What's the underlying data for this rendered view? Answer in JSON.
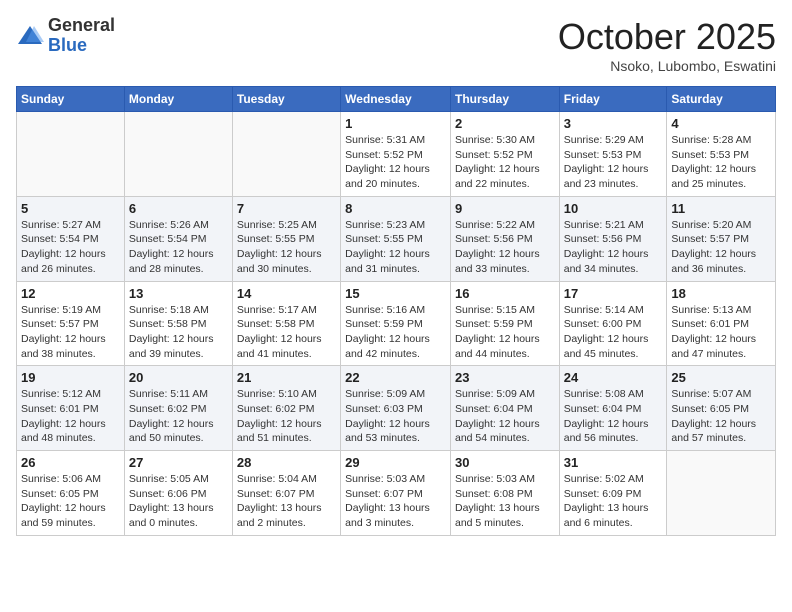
{
  "header": {
    "logo_general": "General",
    "logo_blue": "Blue",
    "month_year": "October 2025",
    "location": "Nsoko, Lubombo, Eswatini"
  },
  "weekdays": [
    "Sunday",
    "Monday",
    "Tuesday",
    "Wednesday",
    "Thursday",
    "Friday",
    "Saturday"
  ],
  "weeks": [
    [
      {
        "day": "",
        "sunrise": "",
        "sunset": "",
        "daylight": ""
      },
      {
        "day": "",
        "sunrise": "",
        "sunset": "",
        "daylight": ""
      },
      {
        "day": "",
        "sunrise": "",
        "sunset": "",
        "daylight": ""
      },
      {
        "day": "1",
        "sunrise": "Sunrise: 5:31 AM",
        "sunset": "Sunset: 5:52 PM",
        "daylight": "Daylight: 12 hours and 20 minutes."
      },
      {
        "day": "2",
        "sunrise": "Sunrise: 5:30 AM",
        "sunset": "Sunset: 5:52 PM",
        "daylight": "Daylight: 12 hours and 22 minutes."
      },
      {
        "day": "3",
        "sunrise": "Sunrise: 5:29 AM",
        "sunset": "Sunset: 5:53 PM",
        "daylight": "Daylight: 12 hours and 23 minutes."
      },
      {
        "day": "4",
        "sunrise": "Sunrise: 5:28 AM",
        "sunset": "Sunset: 5:53 PM",
        "daylight": "Daylight: 12 hours and 25 minutes."
      }
    ],
    [
      {
        "day": "5",
        "sunrise": "Sunrise: 5:27 AM",
        "sunset": "Sunset: 5:54 PM",
        "daylight": "Daylight: 12 hours and 26 minutes."
      },
      {
        "day": "6",
        "sunrise": "Sunrise: 5:26 AM",
        "sunset": "Sunset: 5:54 PM",
        "daylight": "Daylight: 12 hours and 28 minutes."
      },
      {
        "day": "7",
        "sunrise": "Sunrise: 5:25 AM",
        "sunset": "Sunset: 5:55 PM",
        "daylight": "Daylight: 12 hours and 30 minutes."
      },
      {
        "day": "8",
        "sunrise": "Sunrise: 5:23 AM",
        "sunset": "Sunset: 5:55 PM",
        "daylight": "Daylight: 12 hours and 31 minutes."
      },
      {
        "day": "9",
        "sunrise": "Sunrise: 5:22 AM",
        "sunset": "Sunset: 5:56 PM",
        "daylight": "Daylight: 12 hours and 33 minutes."
      },
      {
        "day": "10",
        "sunrise": "Sunrise: 5:21 AM",
        "sunset": "Sunset: 5:56 PM",
        "daylight": "Daylight: 12 hours and 34 minutes."
      },
      {
        "day": "11",
        "sunrise": "Sunrise: 5:20 AM",
        "sunset": "Sunset: 5:57 PM",
        "daylight": "Daylight: 12 hours and 36 minutes."
      }
    ],
    [
      {
        "day": "12",
        "sunrise": "Sunrise: 5:19 AM",
        "sunset": "Sunset: 5:57 PM",
        "daylight": "Daylight: 12 hours and 38 minutes."
      },
      {
        "day": "13",
        "sunrise": "Sunrise: 5:18 AM",
        "sunset": "Sunset: 5:58 PM",
        "daylight": "Daylight: 12 hours and 39 minutes."
      },
      {
        "day": "14",
        "sunrise": "Sunrise: 5:17 AM",
        "sunset": "Sunset: 5:58 PM",
        "daylight": "Daylight: 12 hours and 41 minutes."
      },
      {
        "day": "15",
        "sunrise": "Sunrise: 5:16 AM",
        "sunset": "Sunset: 5:59 PM",
        "daylight": "Daylight: 12 hours and 42 minutes."
      },
      {
        "day": "16",
        "sunrise": "Sunrise: 5:15 AM",
        "sunset": "Sunset: 5:59 PM",
        "daylight": "Daylight: 12 hours and 44 minutes."
      },
      {
        "day": "17",
        "sunrise": "Sunrise: 5:14 AM",
        "sunset": "Sunset: 6:00 PM",
        "daylight": "Daylight: 12 hours and 45 minutes."
      },
      {
        "day": "18",
        "sunrise": "Sunrise: 5:13 AM",
        "sunset": "Sunset: 6:01 PM",
        "daylight": "Daylight: 12 hours and 47 minutes."
      }
    ],
    [
      {
        "day": "19",
        "sunrise": "Sunrise: 5:12 AM",
        "sunset": "Sunset: 6:01 PM",
        "daylight": "Daylight: 12 hours and 48 minutes."
      },
      {
        "day": "20",
        "sunrise": "Sunrise: 5:11 AM",
        "sunset": "Sunset: 6:02 PM",
        "daylight": "Daylight: 12 hours and 50 minutes."
      },
      {
        "day": "21",
        "sunrise": "Sunrise: 5:10 AM",
        "sunset": "Sunset: 6:02 PM",
        "daylight": "Daylight: 12 hours and 51 minutes."
      },
      {
        "day": "22",
        "sunrise": "Sunrise: 5:09 AM",
        "sunset": "Sunset: 6:03 PM",
        "daylight": "Daylight: 12 hours and 53 minutes."
      },
      {
        "day": "23",
        "sunrise": "Sunrise: 5:09 AM",
        "sunset": "Sunset: 6:04 PM",
        "daylight": "Daylight: 12 hours and 54 minutes."
      },
      {
        "day": "24",
        "sunrise": "Sunrise: 5:08 AM",
        "sunset": "Sunset: 6:04 PM",
        "daylight": "Daylight: 12 hours and 56 minutes."
      },
      {
        "day": "25",
        "sunrise": "Sunrise: 5:07 AM",
        "sunset": "Sunset: 6:05 PM",
        "daylight": "Daylight: 12 hours and 57 minutes."
      }
    ],
    [
      {
        "day": "26",
        "sunrise": "Sunrise: 5:06 AM",
        "sunset": "Sunset: 6:05 PM",
        "daylight": "Daylight: 12 hours and 59 minutes."
      },
      {
        "day": "27",
        "sunrise": "Sunrise: 5:05 AM",
        "sunset": "Sunset: 6:06 PM",
        "daylight": "Daylight: 13 hours and 0 minutes."
      },
      {
        "day": "28",
        "sunrise": "Sunrise: 5:04 AM",
        "sunset": "Sunset: 6:07 PM",
        "daylight": "Daylight: 13 hours and 2 minutes."
      },
      {
        "day": "29",
        "sunrise": "Sunrise: 5:03 AM",
        "sunset": "Sunset: 6:07 PM",
        "daylight": "Daylight: 13 hours and 3 minutes."
      },
      {
        "day": "30",
        "sunrise": "Sunrise: 5:03 AM",
        "sunset": "Sunset: 6:08 PM",
        "daylight": "Daylight: 13 hours and 5 minutes."
      },
      {
        "day": "31",
        "sunrise": "Sunrise: 5:02 AM",
        "sunset": "Sunset: 6:09 PM",
        "daylight": "Daylight: 13 hours and 6 minutes."
      },
      {
        "day": "",
        "sunrise": "",
        "sunset": "",
        "daylight": ""
      }
    ]
  ]
}
